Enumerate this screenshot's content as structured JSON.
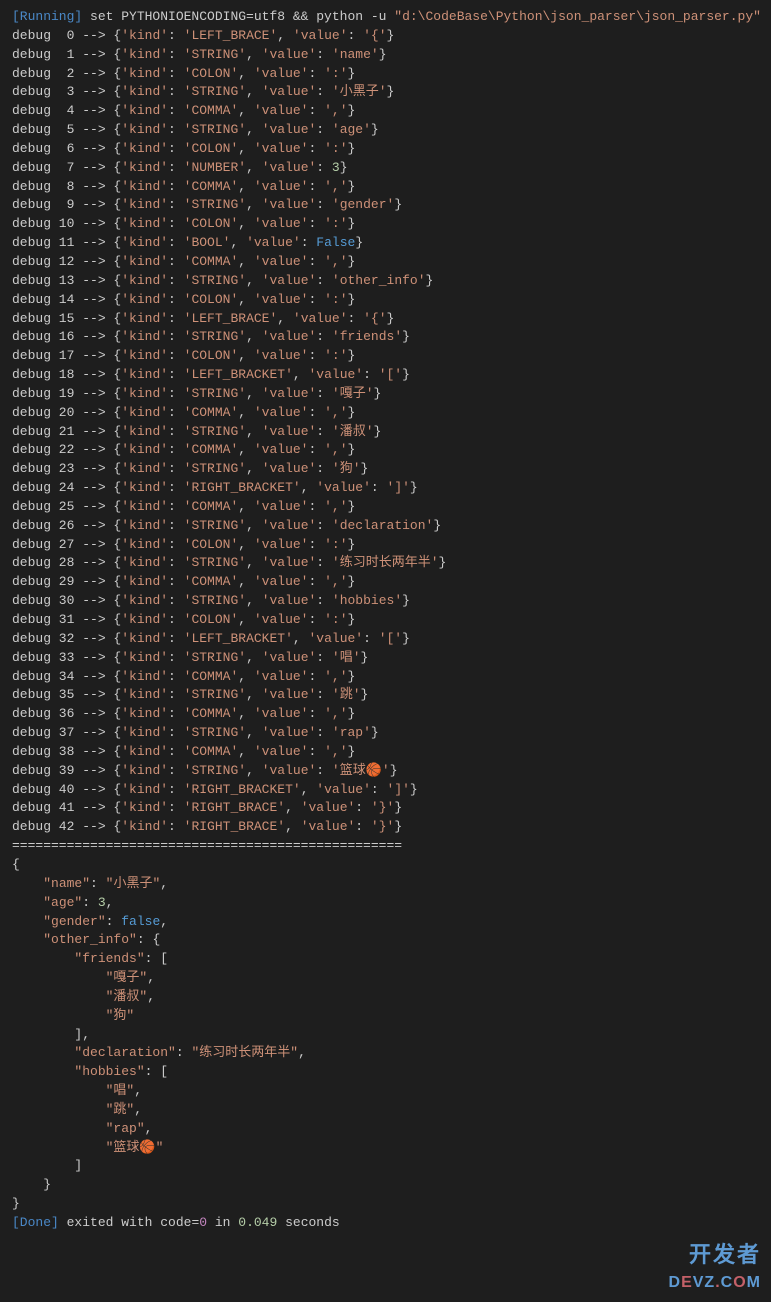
{
  "header": {
    "running_label": "[Running]",
    "cmd_prefix": " set PYTHONIOENCODING=utf8 && python -u ",
    "cmd_path": "\"d:\\CodeBase\\Python\\json_parser\\json_parser.py\""
  },
  "debug_lines": [
    {
      "idx": 0,
      "kind": "LEFT_BRACE",
      "value": "'{'",
      "vtype": "str"
    },
    {
      "idx": 1,
      "kind": "STRING",
      "value": "'name'",
      "vtype": "str"
    },
    {
      "idx": 2,
      "kind": "COLON",
      "value": "':'",
      "vtype": "str"
    },
    {
      "idx": 3,
      "kind": "STRING",
      "value": "'小黑子'",
      "vtype": "str"
    },
    {
      "idx": 4,
      "kind": "COMMA",
      "value": "','",
      "vtype": "str"
    },
    {
      "idx": 5,
      "kind": "STRING",
      "value": "'age'",
      "vtype": "str"
    },
    {
      "idx": 6,
      "kind": "COLON",
      "value": "':'",
      "vtype": "str"
    },
    {
      "idx": 7,
      "kind": "NUMBER",
      "value": "3",
      "vtype": "num"
    },
    {
      "idx": 8,
      "kind": "COMMA",
      "value": "','",
      "vtype": "str"
    },
    {
      "idx": 9,
      "kind": "STRING",
      "value": "'gender'",
      "vtype": "str"
    },
    {
      "idx": 10,
      "kind": "COLON",
      "value": "':'",
      "vtype": "str"
    },
    {
      "idx": 11,
      "kind": "BOOL",
      "value": "False",
      "vtype": "bool"
    },
    {
      "idx": 12,
      "kind": "COMMA",
      "value": "','",
      "vtype": "str"
    },
    {
      "idx": 13,
      "kind": "STRING",
      "value": "'other_info'",
      "vtype": "str"
    },
    {
      "idx": 14,
      "kind": "COLON",
      "value": "':'",
      "vtype": "str"
    },
    {
      "idx": 15,
      "kind": "LEFT_BRACE",
      "value": "'{'",
      "vtype": "str"
    },
    {
      "idx": 16,
      "kind": "STRING",
      "value": "'friends'",
      "vtype": "str"
    },
    {
      "idx": 17,
      "kind": "COLON",
      "value": "':'",
      "vtype": "str"
    },
    {
      "idx": 18,
      "kind": "LEFT_BRACKET",
      "value": "'['",
      "vtype": "str"
    },
    {
      "idx": 19,
      "kind": "STRING",
      "value": "'嘎子'",
      "vtype": "str"
    },
    {
      "idx": 20,
      "kind": "COMMA",
      "value": "','",
      "vtype": "str"
    },
    {
      "idx": 21,
      "kind": "STRING",
      "value": "'潘叔'",
      "vtype": "str"
    },
    {
      "idx": 22,
      "kind": "COMMA",
      "value": "','",
      "vtype": "str"
    },
    {
      "idx": 23,
      "kind": "STRING",
      "value": "'狗'",
      "vtype": "str"
    },
    {
      "idx": 24,
      "kind": "RIGHT_BRACKET",
      "value": "']'",
      "vtype": "str"
    },
    {
      "idx": 25,
      "kind": "COMMA",
      "value": "','",
      "vtype": "str"
    },
    {
      "idx": 26,
      "kind": "STRING",
      "value": "'declaration'",
      "vtype": "str"
    },
    {
      "idx": 27,
      "kind": "COLON",
      "value": "':'",
      "vtype": "str"
    },
    {
      "idx": 28,
      "kind": "STRING",
      "value": "'练习时长两年半'",
      "vtype": "str"
    },
    {
      "idx": 29,
      "kind": "COMMA",
      "value": "','",
      "vtype": "str"
    },
    {
      "idx": 30,
      "kind": "STRING",
      "value": "'hobbies'",
      "vtype": "str"
    },
    {
      "idx": 31,
      "kind": "COLON",
      "value": "':'",
      "vtype": "str"
    },
    {
      "idx": 32,
      "kind": "LEFT_BRACKET",
      "value": "'['",
      "vtype": "str"
    },
    {
      "idx": 33,
      "kind": "STRING",
      "value": "'唱'",
      "vtype": "str"
    },
    {
      "idx": 34,
      "kind": "COMMA",
      "value": "','",
      "vtype": "str"
    },
    {
      "idx": 35,
      "kind": "STRING",
      "value": "'跳'",
      "vtype": "str"
    },
    {
      "idx": 36,
      "kind": "COMMA",
      "value": "','",
      "vtype": "str"
    },
    {
      "idx": 37,
      "kind": "STRING",
      "value": "'rap'",
      "vtype": "str"
    },
    {
      "idx": 38,
      "kind": "COMMA",
      "value": "','",
      "vtype": "str"
    },
    {
      "idx": 39,
      "kind": "STRING",
      "value": "'篮球🏀'",
      "vtype": "str"
    },
    {
      "idx": 40,
      "kind": "RIGHT_BRACKET",
      "value": "']'",
      "vtype": "str"
    },
    {
      "idx": 41,
      "kind": "RIGHT_BRACE",
      "value": "'}'",
      "vtype": "str"
    },
    {
      "idx": 42,
      "kind": "RIGHT_BRACE",
      "value": "'}'",
      "vtype": "str"
    }
  ],
  "separator": "==================================================",
  "json_output": [
    {
      "indent": 0,
      "text": "{",
      "type": "punct"
    },
    {
      "indent": 1,
      "key": "\"name\"",
      "sep": ": ",
      "val": "\"小黑子\"",
      "vtype": "str",
      "comma": ","
    },
    {
      "indent": 1,
      "key": "\"age\"",
      "sep": ": ",
      "val": "3",
      "vtype": "num",
      "comma": ","
    },
    {
      "indent": 1,
      "key": "\"gender\"",
      "sep": ": ",
      "val": "false",
      "vtype": "bool",
      "comma": ","
    },
    {
      "indent": 1,
      "key": "\"other_info\"",
      "sep": ": ",
      "val": "{",
      "vtype": "punct",
      "comma": ""
    },
    {
      "indent": 2,
      "key": "\"friends\"",
      "sep": ": ",
      "val": "[",
      "vtype": "punct",
      "comma": ""
    },
    {
      "indent": 3,
      "val": "\"嘎子\"",
      "vtype": "str",
      "comma": ","
    },
    {
      "indent": 3,
      "val": "\"潘叔\"",
      "vtype": "str",
      "comma": ","
    },
    {
      "indent": 3,
      "val": "\"狗\"",
      "vtype": "str",
      "comma": ""
    },
    {
      "indent": 2,
      "text": "],",
      "type": "punct"
    },
    {
      "indent": 2,
      "key": "\"declaration\"",
      "sep": ": ",
      "val": "\"练习时长两年半\"",
      "vtype": "str",
      "comma": ","
    },
    {
      "indent": 2,
      "key": "\"hobbies\"",
      "sep": ": ",
      "val": "[",
      "vtype": "punct",
      "comma": ""
    },
    {
      "indent": 3,
      "val": "\"唱\"",
      "vtype": "str",
      "comma": ","
    },
    {
      "indent": 3,
      "val": "\"跳\"",
      "vtype": "str",
      "comma": ","
    },
    {
      "indent": 3,
      "val": "\"rap\"",
      "vtype": "str",
      "comma": ","
    },
    {
      "indent": 3,
      "val": "\"篮球🏀\"",
      "vtype": "str",
      "comma": ""
    },
    {
      "indent": 2,
      "text": "]",
      "type": "punct"
    },
    {
      "indent": 1,
      "text": "}",
      "type": "punct"
    },
    {
      "indent": 0,
      "text": "}",
      "type": "punct"
    }
  ],
  "footer": {
    "done_label": "[Done]",
    "exited_text": " exited with ",
    "code_label": "code=",
    "code_value": "0",
    "in_text": " in ",
    "time_value": "0.049",
    "seconds_text": " seconds"
  },
  "watermark": {
    "cn": "开发者",
    "en_pre": "D",
    "en_red": "E",
    "en_mid": "VZ",
    "en_dot": ".",
    "en_c": "C",
    "en_o": "O",
    "en_m": "M"
  }
}
